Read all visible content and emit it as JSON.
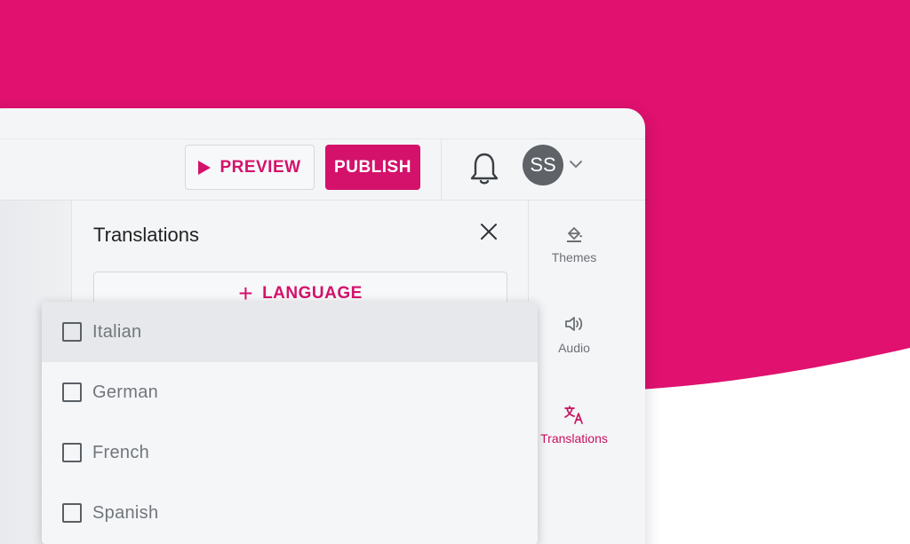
{
  "colors": {
    "brand": "#e0116f",
    "accent": "#d4126b"
  },
  "toolbar": {
    "preview_label": "PREVIEW",
    "publish_label": "PUBLISH",
    "avatar_initials": "SS"
  },
  "panel": {
    "title": "Translations",
    "add_language_label": "LANGUAGE"
  },
  "rail": {
    "items": [
      {
        "label": "Themes",
        "icon": "paint-bucket-icon"
      },
      {
        "label": "Audio",
        "icon": "speaker-icon"
      },
      {
        "label": "Translations",
        "icon": "translate-icon",
        "active": true
      }
    ]
  },
  "dropdown": {
    "options": [
      {
        "label": "Italian",
        "checked": false
      },
      {
        "label": "German",
        "checked": false
      },
      {
        "label": "French",
        "checked": false
      },
      {
        "label": "Spanish",
        "checked": false
      }
    ]
  }
}
